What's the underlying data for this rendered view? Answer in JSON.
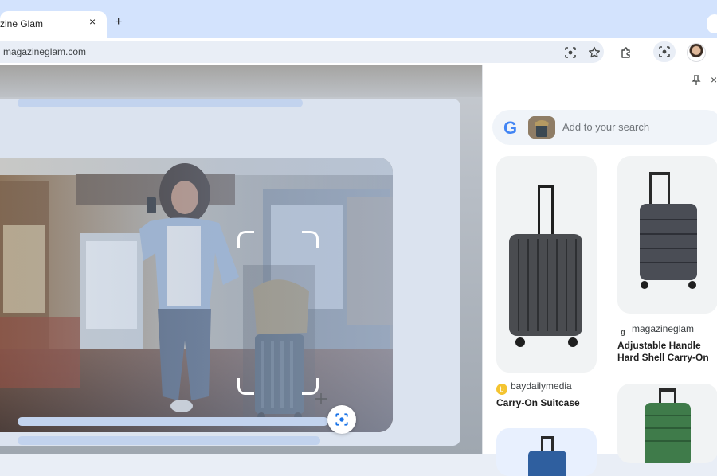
{
  "browser": {
    "tab": {
      "title": "zine Glam",
      "close_label": "×"
    },
    "new_tab_label": "+",
    "address": {
      "url": "magazineglam.com"
    }
  },
  "side_panel": {
    "close_label": "×",
    "search": {
      "placeholder": "Add to your search",
      "logo_text": "G"
    },
    "results": [
      {
        "source": "baydailymedia",
        "title": "Carry-On Suitcase",
        "suitcase_color": "#4a4c50"
      },
      {
        "source": "magazineglam",
        "title": "Adjustable Handle Hard Shell Carry-On",
        "suitcase_color": "#4a4d55"
      },
      {
        "suitcase_color": "#3f7b4a"
      },
      {
        "suitcase_color": "#2f5f9f"
      }
    ]
  },
  "colors": {
    "accent": "#1a73e8",
    "tab_strip": "#d3e3fd",
    "result_card_bg": "#f1f3f4"
  }
}
